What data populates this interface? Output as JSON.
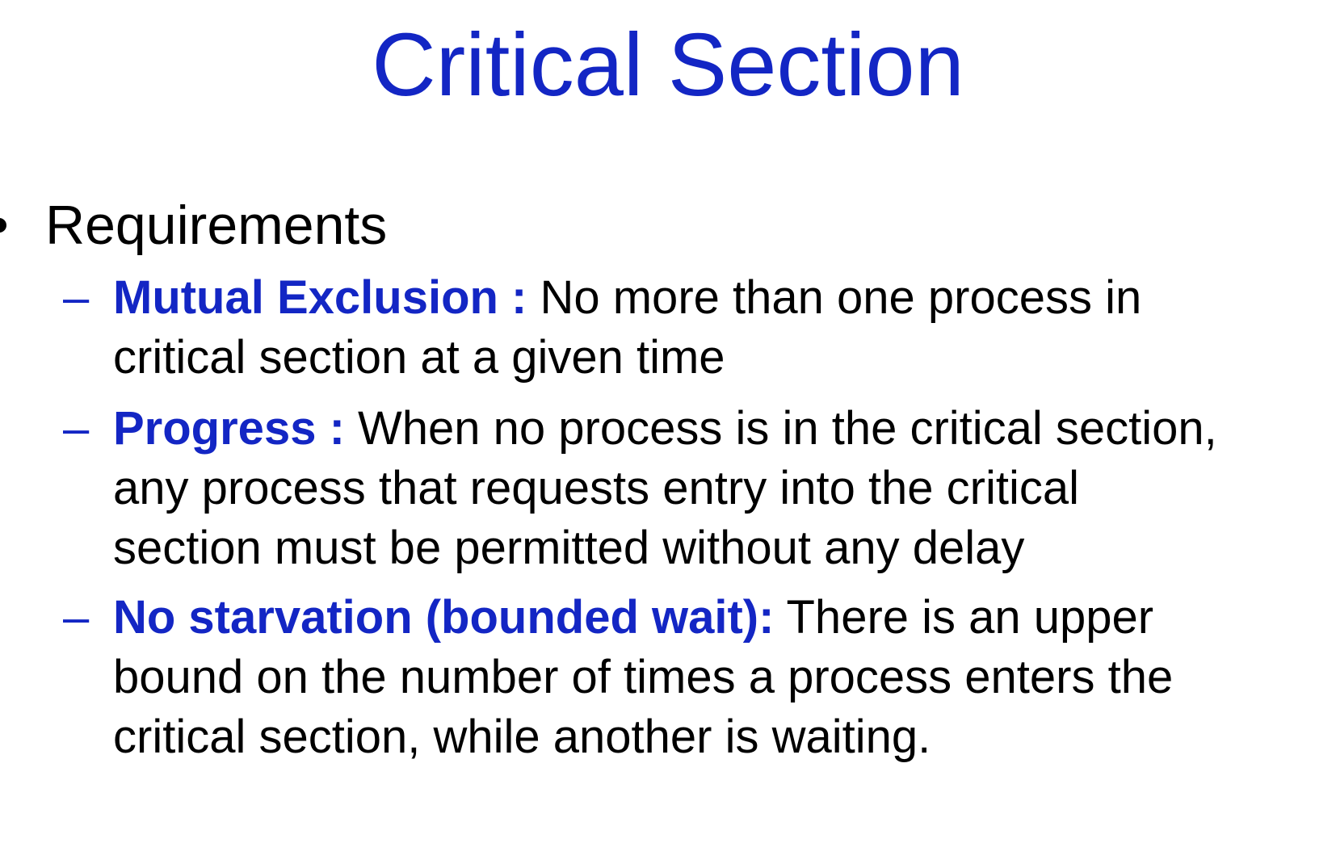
{
  "slide": {
    "title": "Critical Section",
    "bullet": "Requirements",
    "items": [
      {
        "term": "Mutual Exclusion :",
        "first_line": " No more than one process in",
        "lines": [
          "critical section at a given time"
        ]
      },
      {
        "term": "Progress :",
        "first_line": " When no process is in the critical section,",
        "lines": [
          "any process that requests entry into the critical",
          "section must be permitted without any delay"
        ]
      },
      {
        "term": "No starvation (bounded wait):",
        "first_line": " There is an upper",
        "lines": [
          "bound on the number of times a process enters the",
          "critical section, while another is waiting."
        ]
      }
    ],
    "dash": "–",
    "colors": {
      "accent": "#1326c4",
      "text": "#000000",
      "background": "#ffffff"
    }
  }
}
